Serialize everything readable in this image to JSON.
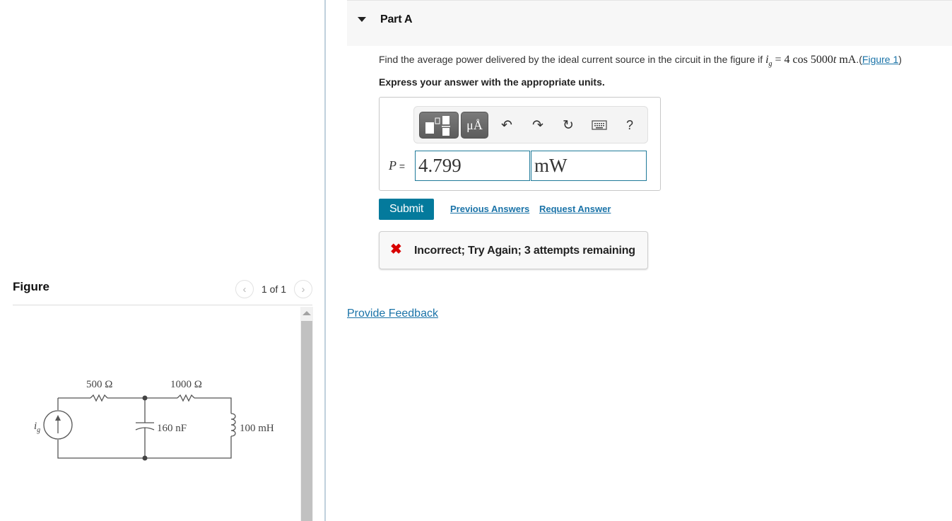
{
  "figure_panel": {
    "title": "Figure",
    "pager_text": "1 of 1",
    "prev_icon": "chevron-left-icon",
    "next_icon": "chevron-right-icon",
    "circuit": {
      "source_label": "i",
      "source_subscript": "g",
      "resistor1": "500 Ω",
      "resistor2": "1000 Ω",
      "capacitor": "160 nF",
      "inductor": "100 mH"
    }
  },
  "part": {
    "title": "Part A",
    "question_prefix": "Find the average power delivered by the ideal current source in the circuit in the figure if ",
    "equation": {
      "var": "i",
      "sub": "g",
      "rhs": " = 4 cos 5000",
      "t": "t",
      "unit": " mA"
    },
    "figure_link_open": ".(",
    "figure_link": "Figure 1",
    "figure_link_close": ")",
    "instruction": "Express your answer with the appropriate units."
  },
  "answer": {
    "toolbar": {
      "templates_icon": "templates-icon",
      "units_label": "μÅ",
      "undo_icon": "undo-icon",
      "redo_icon": "redo-icon",
      "reset_icon": "reset-icon",
      "keyboard_icon": "keyboard-icon",
      "help_label": "?"
    },
    "variable": "P",
    "equals": " =",
    "value": "4.799",
    "unit": "mW"
  },
  "actions": {
    "submit": "Submit",
    "previous_answers": "Previous Answers",
    "request_answer": "Request Answer"
  },
  "feedback": {
    "status": "incorrect",
    "icon": "✖",
    "message": "Incorrect; Try Again; 3 attempts remaining",
    "color": "#d80000"
  },
  "provide_feedback": "Provide Feedback",
  "colors": {
    "accent": "#047a9c",
    "link": "#1a73a8",
    "input_border": "#1f7a99"
  }
}
